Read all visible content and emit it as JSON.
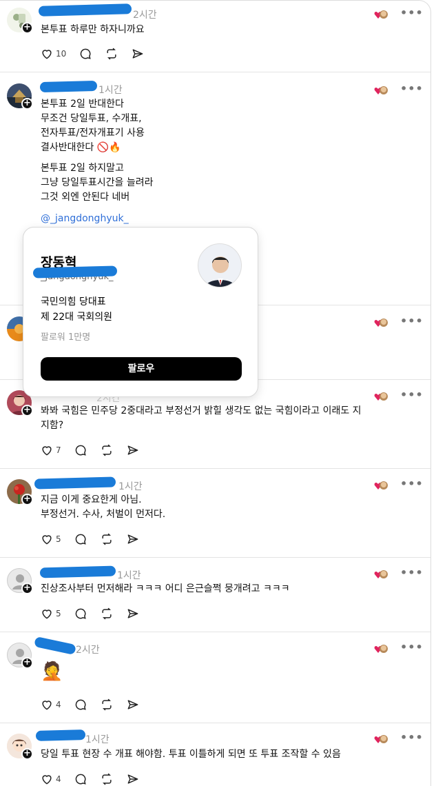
{
  "posts": [
    {
      "id": 1,
      "time": "2시간",
      "text": "본투표 하루만 하자니까요",
      "likes": "10",
      "avatar": "cartoon-avatar"
    },
    {
      "id": 2,
      "time": "1시간",
      "text": "본투표 2일 반대한다\n무조건 당일투표, 수개표,\n전자투표/전자개표기 사용\n결사반대한다 🚫🔥",
      "text2": "본투표 2일 하지말고\n그냥 당일투표시간을 늘려라\n그것 외엔 안된다 네버",
      "mention": "@_jangdonghyuk_",
      "avatar": "palace-avatar"
    },
    {
      "id": 3,
      "avatar": "sunset-avatar"
    },
    {
      "id": 4,
      "time": "2시간",
      "text": "봐봐 국힘은 민주당 2중대라고 부정선거 밝힐 생각도 없는 국힘이라고 이래도 지\n지함?",
      "likes": "7",
      "avatar": "woman-avatar"
    },
    {
      "id": 5,
      "time": "1시간",
      "text": "지금 이게 중요한게 아님.\n부정선거. 수사, 처벌이 먼저다.",
      "likes": "5",
      "avatar": "flower-avatar"
    },
    {
      "id": 6,
      "time": "1시간",
      "text": "진상조사부터 먼저해라 ㅋㅋㅋ 어디 은근슬쩍 뭉개려고 ㅋㅋㅋ",
      "likes": "5",
      "avatar": "default-avatar"
    },
    {
      "id": 7,
      "time": "2시간",
      "text": "🤦",
      "likes": "4",
      "avatar": "default-avatar"
    },
    {
      "id": 8,
      "time": "1시간",
      "text": "당일 투표 현장 수 개표 해야함. 투표 이틀하게 되면 또 투표 조작할 수 있음",
      "likes": "4",
      "avatar": "cartoon-avatar"
    }
  ],
  "card": {
    "name": "장동혁",
    "handle": "_jangdonghyuk_",
    "bio": "국민의힘 당대표\n제 22대 국회의원",
    "followers": "팔로워 1만명",
    "follow_label": "팔로우"
  },
  "colors": {
    "like_heart": "#e0245e",
    "link": "#2f6fd8",
    "redaction": "#1a7bd8"
  },
  "icons": [
    "heart-icon",
    "comment-icon",
    "repost-icon",
    "share-icon",
    "more-icon",
    "follow-plus-icon"
  ]
}
